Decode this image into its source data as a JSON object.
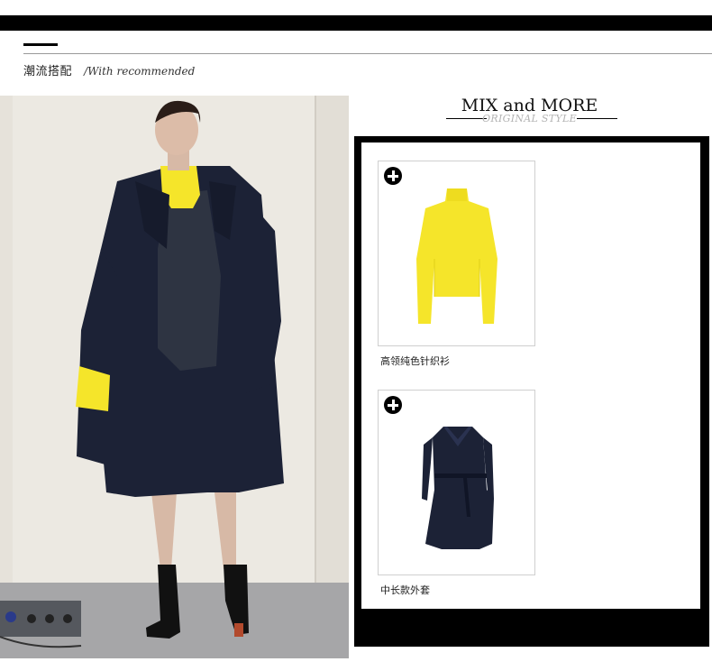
{
  "section": {
    "title": "潮流搭配",
    "subtitle": "/With recommended"
  },
  "mix": {
    "title": "MIX and MORE",
    "subtitle": "ORIGINAL STYLE"
  },
  "products": [
    {
      "name": "高领纯色针织衫",
      "icon": "plus-circle-icon",
      "color": "#f5e52a"
    },
    {
      "name": "中长款外套",
      "icon": "plus-circle-icon",
      "color": "#1c2236"
    }
  ],
  "colors": {
    "bar": "#000000",
    "coat": "#1c2236",
    "sweater": "#f5e52a",
    "subtitle_gray": "#b3b3b3"
  }
}
